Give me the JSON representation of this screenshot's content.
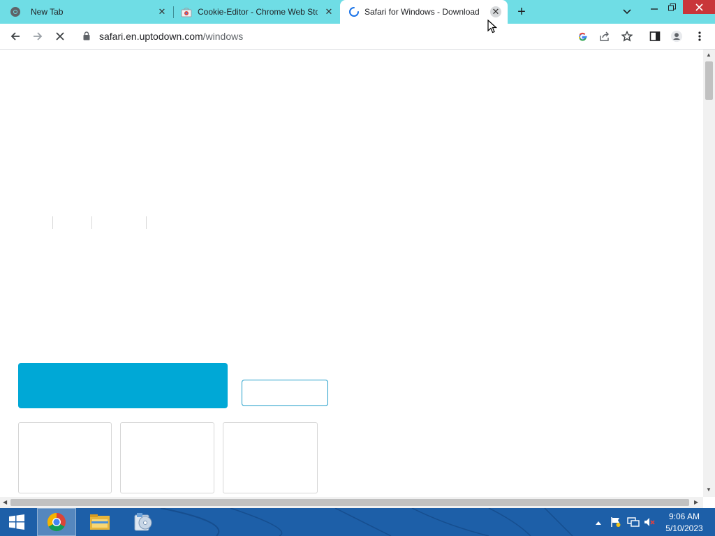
{
  "browser": {
    "tabs": [
      {
        "title": "New Tab",
        "active": false,
        "favicon": "chrome-icon"
      },
      {
        "title": "Cookie-Editor - Chrome Web Sto",
        "active": false,
        "favicon": "chrome-web-store-icon"
      },
      {
        "title": "Safari for Windows - Download it",
        "active": true,
        "favicon": "loading-spinner-icon"
      }
    ],
    "new_tab_symbol": "+",
    "close_symbol": "✕"
  },
  "toolbar": {
    "url_host": "safari.en.uptodown.com",
    "url_path": "/windows"
  },
  "taskbar": {
    "time": "9:06 AM",
    "date": "5/10/2023",
    "apps": [
      "start-button",
      "chrome-icon",
      "file-explorer-icon",
      "media-app-icon"
    ]
  },
  "colors": {
    "tabstrip": "#6fdde5",
    "download_button": "#00a8d6",
    "taskbar": "#1d5fa8"
  }
}
